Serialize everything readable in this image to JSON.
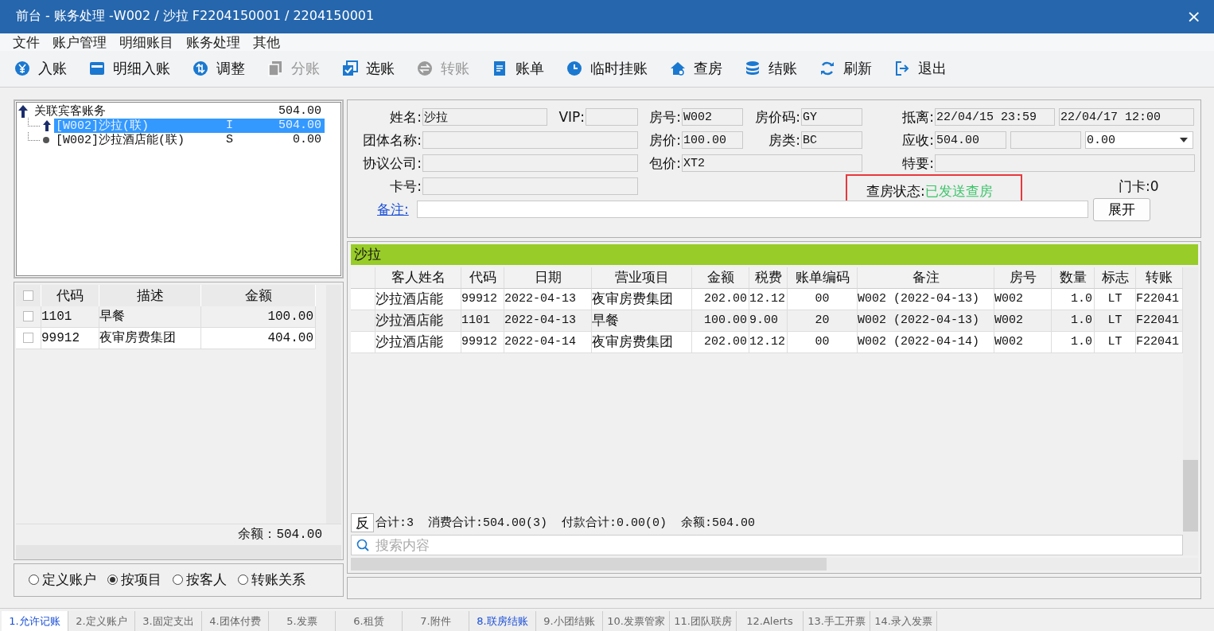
{
  "window": {
    "title": "前台 - 账务处理 -W002 / 沙拉 F2204150001 / 2204150001",
    "close": "×"
  },
  "menu": [
    "文件",
    "账户管理",
    "明细账目",
    "账务处理",
    "其他"
  ],
  "toolbar": [
    {
      "label": "入账",
      "disabled": false
    },
    {
      "label": "明细入账",
      "disabled": false
    },
    {
      "label": "调整",
      "disabled": false
    },
    {
      "label": "分账",
      "disabled": true
    },
    {
      "label": "选账",
      "disabled": false
    },
    {
      "label": "转账",
      "disabled": true
    },
    {
      "label": "账单",
      "disabled": false
    },
    {
      "label": "临时挂账",
      "disabled": false
    },
    {
      "label": "查房",
      "disabled": false
    },
    {
      "label": "结账",
      "disabled": false
    },
    {
      "label": "刷新",
      "disabled": false
    },
    {
      "label": "退出",
      "disabled": false
    }
  ],
  "accounts_tree": {
    "label": "关联宾客账务",
    "amount": "504.00",
    "children": [
      {
        "label": "[W002]沙拉(联)",
        "type": "I",
        "amount": "504.00",
        "selected": true
      },
      {
        "label": "[W002]沙拉酒店能(联)",
        "type": "S",
        "amount": "0.00",
        "selected": false
      }
    ]
  },
  "item_list": {
    "header_checked": false,
    "columns": [
      "代码",
      "描述",
      "金额"
    ],
    "rows": [
      {
        "checked": false,
        "cells": [
          "1101",
          "早餐",
          "100.00"
        ]
      },
      {
        "checked": false,
        "cells": [
          "99912",
          "夜审房费集团",
          "404.00"
        ]
      }
    ],
    "balance": "余额：504.00"
  },
  "view_options": [
    {
      "label": "定义账户",
      "selected": false
    },
    {
      "label": "按项目",
      "selected": true
    },
    {
      "label": "按客人",
      "selected": false
    },
    {
      "label": "转账关系",
      "selected": false
    }
  ],
  "guest_info": {
    "fields": [
      {
        "kind": "field",
        "label": "姓名:",
        "value": "沙拉"
      },
      {
        "kind": "field",
        "label": "VIP:"
      },
      {
        "kind": "field",
        "label": "房号:",
        "value": "W002"
      },
      {
        "kind": "field",
        "label": "房价码:",
        "value": "GY"
      },
      {
        "kind": "field",
        "label": "抵离:",
        "value": "22/04/15 23:59"
      },
      {
        "kind": "field",
        "value": "22/04/17 12:00"
      },
      {
        "kind": "field",
        "label": "团体名称:"
      },
      {
        "kind": "field",
        "label": "房价:",
        "value": "100.00"
      },
      {
        "kind": "field",
        "label": "房类:",
        "value": "BC"
      },
      {
        "kind": "field",
        "label": "应收:",
        "value": "504.00"
      },
      {
        "kind": "field"
      },
      {
        "kind": "dropdown",
        "value": "0.00"
      },
      {
        "kind": "field",
        "label": "协议公司:"
      },
      {
        "kind": "field",
        "label": "包价:",
        "value": "XT2"
      },
      {
        "kind": "field",
        "label": "特要:"
      },
      {
        "kind": "field",
        "label": "卡号:"
      },
      {
        "kind": "status",
        "label": "查房状态:",
        "value": "已发送查房",
        "highlighted": true
      },
      {
        "kind": "text",
        "value": "门卡:0"
      },
      {
        "kind": "link_field",
        "label": "备注:"
      },
      {
        "kind": "button",
        "label": "展开"
      }
    ]
  },
  "folio": {
    "title": "沙拉",
    "columns": [
      "客人姓名",
      "代码",
      "日期",
      "营业项目",
      "金额",
      "税费",
      "账单编码",
      "备注",
      "房号",
      "数量",
      "标志",
      "转账"
    ],
    "rows": [
      {
        "selected": false,
        "cells": [
          "沙拉酒店能",
          "99912",
          "2022-04-13",
          "夜审房费集团",
          "202.00",
          "12.12",
          "00",
          "W002 (2022-04-13)",
          "W002",
          "1.0",
          "LT",
          "F22041"
        ]
      },
      {
        "selected": true,
        "cells": [
          "沙拉酒店能",
          "1101",
          "2022-04-13",
          "早餐",
          "100.00",
          "9.00",
          "20",
          "W002 (2022-04-13)",
          "W002",
          "1.0",
          "LT",
          "F22041"
        ]
      },
      {
        "selected": false,
        "cells": [
          "沙拉酒店能",
          "99912",
          "2022-04-14",
          "夜审房费集团",
          "202.00",
          "12.12",
          "00",
          "W002 (2022-04-14)",
          "W002",
          "1.0",
          "LT",
          "F22041"
        ]
      }
    ],
    "reverse_button": "反",
    "totals": [
      "合计:3",
      "消费合计:504.00(3)",
      "付款合计:0.00(0)",
      "余额:504.00"
    ],
    "search": {
      "placeholder": "搜索内容"
    }
  },
  "tabs": [
    {
      "label": "1.允许记账",
      "selected": true,
      "highlighted": false
    },
    {
      "label": "2.定义账户",
      "selected": false,
      "highlighted": false
    },
    {
      "label": "3.固定支出",
      "selected": false,
      "highlighted": false
    },
    {
      "label": "4.团体付费",
      "selected": false,
      "highlighted": false
    },
    {
      "label": "5.发票",
      "selected": false,
      "highlighted": false
    },
    {
      "label": "6.租赁",
      "selected": false,
      "highlighted": false
    },
    {
      "label": "7.附件",
      "selected": false,
      "highlighted": false
    },
    {
      "label": "8.联房结账",
      "selected": false,
      "highlighted": true
    },
    {
      "label": "9.小团结账",
      "selected": false,
      "highlighted": false
    },
    {
      "label": "10.发票管家",
      "selected": false,
      "highlighted": false
    },
    {
      "label": "11.团队联房",
      "selected": false,
      "highlighted": false
    },
    {
      "label": "12.Alerts",
      "selected": false,
      "highlighted": false
    },
    {
      "label": "13.手工开票",
      "selected": false,
      "highlighted": false
    },
    {
      "label": "14.录入发票",
      "selected": false,
      "highlighted": false
    }
  ]
}
